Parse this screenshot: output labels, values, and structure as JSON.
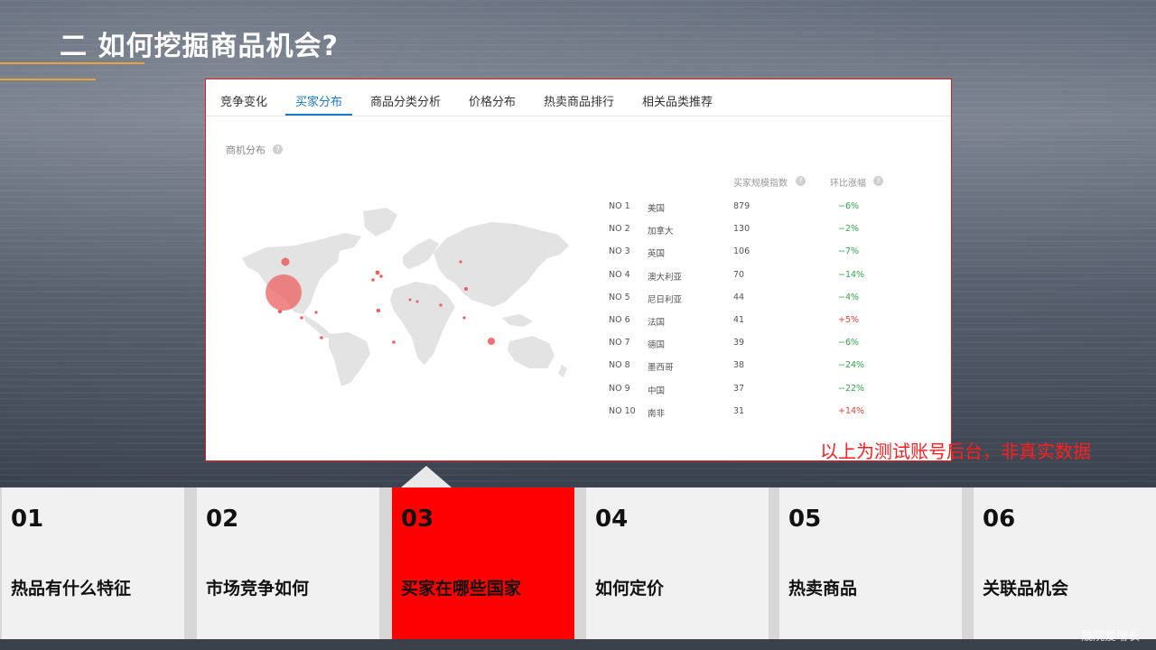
{
  "slide": {
    "title": "二 如何挖掘商品机会?",
    "disclaimer": "以上为测试账号后台，非真实数据",
    "watermark": "晟院爱增长"
  },
  "tabs": [
    {
      "label": "竞争变化",
      "active": false
    },
    {
      "label": "买家分布",
      "active": true
    },
    {
      "label": "商品分类分析",
      "active": false
    },
    {
      "label": "价格分布",
      "active": false
    },
    {
      "label": "热卖商品排行",
      "active": false
    },
    {
      "label": "相关品类推荐",
      "active": false
    }
  ],
  "section": {
    "label": "商机分布",
    "help_icon": "question-icon"
  },
  "table": {
    "headers": {
      "index": "买家规模指数",
      "change": "环比涨幅"
    },
    "rows": [
      {
        "rank": "NO 1",
        "country": "美国",
        "index": "879",
        "change": "−6%",
        "trend": "down"
      },
      {
        "rank": "NO 2",
        "country": "加拿大",
        "index": "130",
        "change": "−2%",
        "trend": "down"
      },
      {
        "rank": "NO 3",
        "country": "英国",
        "index": "106",
        "change": "−7%",
        "trend": "down"
      },
      {
        "rank": "NO 4",
        "country": "澳大利亚",
        "index": "70",
        "change": "−14%",
        "trend": "down"
      },
      {
        "rank": "NO 5",
        "country": "尼日利亚",
        "index": "44",
        "change": "−4%",
        "trend": "down"
      },
      {
        "rank": "NO 6",
        "country": "法国",
        "index": "41",
        "change": "+5%",
        "trend": "up"
      },
      {
        "rank": "NO 7",
        "country": "德国",
        "index": "39",
        "change": "−6%",
        "trend": "down"
      },
      {
        "rank": "NO 8",
        "country": "墨西哥",
        "index": "38",
        "change": "−24%",
        "trend": "down"
      },
      {
        "rank": "NO 9",
        "country": "中国",
        "index": "37",
        "change": "−22%",
        "trend": "down"
      },
      {
        "rank": "NO 10",
        "country": "南非",
        "index": "31",
        "change": "+14%",
        "trend": "up"
      }
    ]
  },
  "nav": [
    {
      "num": "01",
      "label": "热品有什么特征",
      "active": false
    },
    {
      "num": "02",
      "label": "市场竞争如何",
      "active": false
    },
    {
      "num": "03",
      "label": "买家在哪些国家",
      "active": true
    },
    {
      "num": "04",
      "label": "如何定价",
      "active": false
    },
    {
      "num": "05",
      "label": "热卖商品",
      "active": false
    },
    {
      "num": "06",
      "label": "关联品机会",
      "active": false
    }
  ],
  "colors": {
    "accent": "#ff0000",
    "tab_active": "#1a78c2",
    "up": "#e0443a",
    "down": "#2ea84a",
    "title_rule": "#e8a33a"
  }
}
